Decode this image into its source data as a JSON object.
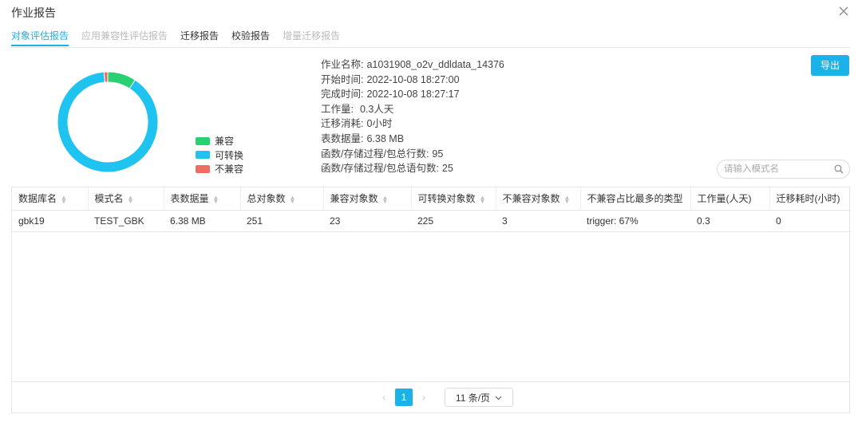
{
  "window": {
    "title": "作业报告"
  },
  "tabs": [
    {
      "label": "对象评估报告",
      "state": "active"
    },
    {
      "label": "应用兼容性评估报告",
      "state": "disabled"
    },
    {
      "label": "迁移报告",
      "state": "enabled"
    },
    {
      "label": "校验报告",
      "state": "enabled"
    },
    {
      "label": "增量迁移报告",
      "state": "disabled"
    }
  ],
  "chart_data": {
    "type": "pie",
    "labels": [
      "兼容",
      "可转换",
      "不兼容"
    ],
    "values": [
      23,
      225,
      3
    ],
    "colors": [
      "#28d072",
      "#1ec3f0",
      "#f06b62"
    ],
    "legend_position": "right"
  },
  "info": {
    "job_name_label": "作业名称:",
    "job_name": "a1031908_o2v_ddldata_14376",
    "start_label": "开始时间:",
    "start": "2022-10-08 18:27:00",
    "finish_label": "完成时间:",
    "finish": "2022-10-08 18:27:17",
    "workload_label": "工作量:",
    "workload": "0.3人天",
    "migration_time_label": "迁移消耗:",
    "migration_time": "0小时",
    "table_size_label": "表数据量:",
    "table_size": "6.38 MB",
    "rows_label": "函数/存储过程/包总行数:",
    "rows": "95",
    "statements_label": "函数/存储过程/包总语句数:",
    "statements": "25"
  },
  "actions": {
    "export_label": "导出"
  },
  "search": {
    "placeholder": "请输入模式名"
  },
  "table": {
    "columns": [
      "数据库名",
      "模式名",
      "表数据量",
      "总对象数",
      "兼容对象数",
      "可转换对象数",
      "不兼容对象数",
      "不兼容占比最多的类型",
      "工作量(人天)",
      "迁移耗时(小时)"
    ],
    "rows": [
      [
        "gbk19",
        "TEST_GBK",
        "6.38 MB",
        "251",
        "23",
        "225",
        "3",
        "trigger: 67%",
        "0.3",
        "0"
      ]
    ]
  },
  "pagination": {
    "current_page": "1",
    "page_size_label": "11 条/页"
  },
  "colors": {
    "accent": "#1ab2e8"
  }
}
